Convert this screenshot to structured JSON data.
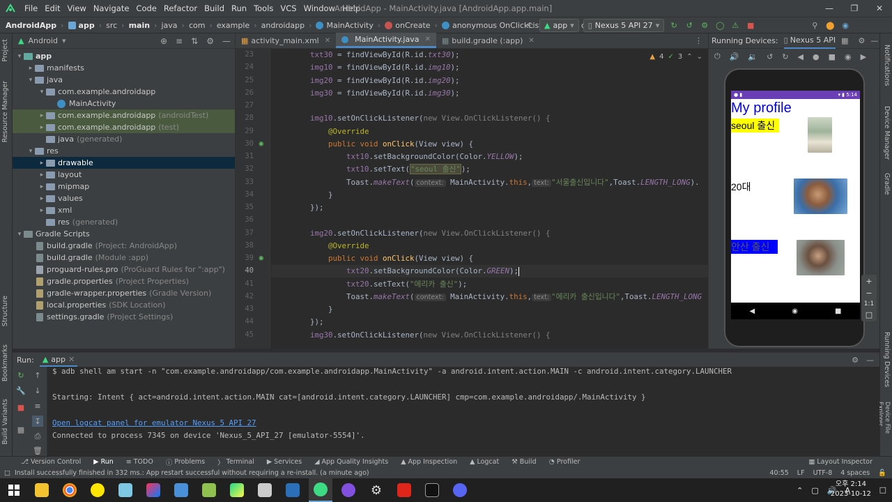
{
  "menu": [
    "File",
    "Edit",
    "View",
    "Navigate",
    "Code",
    "Refactor",
    "Build",
    "Run",
    "Tools",
    "VCS",
    "Window",
    "Help"
  ],
  "window_title": "AndroidApp - MainActivity.java [AndroidApp.app.main]",
  "breadcrumb": [
    "AndroidApp",
    "app",
    "src",
    "main",
    "java",
    "com",
    "example",
    "androidapp",
    "MainActivity",
    "onCreate",
    "anonymous OnClickListener",
    "onClick"
  ],
  "run_config": {
    "module": "app",
    "device": "Nexus 5 API 27"
  },
  "project_panel": {
    "view": "Android"
  },
  "tree": [
    {
      "label": "app",
      "extra": ""
    },
    {
      "label": "manifests",
      "extra": ""
    },
    {
      "label": "java",
      "extra": ""
    },
    {
      "label": "com.example.androidapp",
      "extra": ""
    },
    {
      "label": "MainActivity",
      "extra": ""
    },
    {
      "label": "com.example.androidapp",
      "extra": "(androidTest)"
    },
    {
      "label": "com.example.androidapp",
      "extra": "(test)"
    },
    {
      "label": "java",
      "extra": "(generated)"
    },
    {
      "label": "res",
      "extra": ""
    },
    {
      "label": "drawable",
      "extra": ""
    },
    {
      "label": "layout",
      "extra": ""
    },
    {
      "label": "mipmap",
      "extra": ""
    },
    {
      "label": "values",
      "extra": ""
    },
    {
      "label": "xml",
      "extra": ""
    },
    {
      "label": "res",
      "extra": "(generated)"
    },
    {
      "label": "Gradle Scripts",
      "extra": ""
    },
    {
      "label": "build.gradle",
      "extra": "(Project: AndroidApp)"
    },
    {
      "label": "build.gradle",
      "extra": "(Module :app)"
    },
    {
      "label": "proguard-rules.pro",
      "extra": "(ProGuard Rules for \":app\")"
    },
    {
      "label": "gradle.properties",
      "extra": "(Project Properties)"
    },
    {
      "label": "gradle-wrapper.properties",
      "extra": "(Gradle Version)"
    },
    {
      "label": "local.properties",
      "extra": "(SDK Location)"
    },
    {
      "label": "settings.gradle",
      "extra": "(Project Settings)"
    }
  ],
  "editor_tabs": [
    "activity_main.xml",
    "MainActivity.java",
    "build.gradle (:app)"
  ],
  "inspection": {
    "warnings": "4",
    "ok": "3"
  },
  "line_numbers": [
    "23",
    "24",
    "25",
    "26",
    "27",
    "28",
    "29",
    "30",
    "31",
    "32",
    "33",
    "34",
    "35",
    "36",
    "37",
    "38",
    "39",
    "40",
    "41",
    "42",
    "43",
    "44",
    "45"
  ],
  "devices": {
    "title": "Running Devices:",
    "tab": "Nexus 5 API"
  },
  "emulator": {
    "time": "5:14",
    "profile_title": "My profile",
    "row1": "seoul 출신",
    "row2": "20대",
    "row3": "안산 출신",
    "zoom_label": "1:1"
  },
  "run": {
    "label": "Run:",
    "config": "app",
    "lines": [
      "$ adb shell am start -n \"com.example.androidapp/com.example.androidapp.MainActivity\" -a android.intent.action.MAIN -c android.intent.category.LAUNCHER",
      "Starting: Intent { act=android.intent.action.MAIN cat=[android.intent.category.LAUNCHER] cmp=com.example.androidapp/.MainActivity }",
      "Open logcat panel for emulator Nexus 5 API 27",
      "Connected to process 7345 on device 'Nexus_5_API_27 [emulator-5554]'."
    ]
  },
  "bottom_tools": [
    "Version Control",
    "Run",
    "TODO",
    "Problems",
    "Terminal",
    "Services",
    "App Quality Insights",
    "App Inspection",
    "Logcat",
    "Build",
    "Profiler"
  ],
  "layout_inspector": "Layout Inspector",
  "status": {
    "message": "Install successfully finished in 332 ms.: App restart successful without requiring a re-install. (a minute ago)",
    "position": "40:55",
    "line_sep": "LF",
    "encoding": "UTF-8",
    "indent": "4 spaces"
  },
  "left_tabs": [
    "Project",
    "Resource Manager",
    "Structure",
    "Bookmarks",
    "Build Variants"
  ],
  "right_tabs": [
    "Notifications",
    "Device Manager",
    "Gradle",
    "Running Devices",
    "Device File Explorer"
  ],
  "taskbar": {
    "time": "오후 2:14",
    "date": "2023-10-12",
    "ime": "A"
  },
  "code": {
    "l23": [
      "txt30",
      " = findViewById(R.id.",
      "txt30",
      ");"
    ],
    "l24": [
      "img10",
      " = findViewById(R.id.",
      "img10",
      ");"
    ],
    "l25": [
      "img20",
      " = findViewById(R.id.",
      "img20",
      ");"
    ],
    "l26": [
      "img30",
      " = findViewById(R.id.",
      "img30",
      ");"
    ],
    "l28": [
      "img10",
      ".setOnClickListener(",
      "new View.OnClickListener() {"
    ],
    "l29": "@Override",
    "l30": [
      "public void ",
      "onClick",
      "(View view) {"
    ],
    "l31": [
      "txt10",
      ".setBackgroundColor(Color.",
      "YELLOW",
      ");"
    ],
    "l32": [
      "txt10",
      ".setText(",
      "\"seoul 출신\"",
      ");"
    ],
    "l33": [
      "Toast.",
      "makeText",
      "(",
      "context:",
      " MainActivity.",
      "this",
      ",",
      "text:",
      "\"서울출신입니다\"",
      ",Toast.",
      "LENGTH_LONG",
      ")."
    ],
    "l34": "}",
    "l35": "});",
    "l37": [
      "img20",
      ".setOnClickListener(",
      "new View.OnClickListener() {"
    ],
    "l38": "@Override",
    "l39": [
      "public void ",
      "onClick",
      "(View view) {"
    ],
    "l40": [
      "txt20",
      ".setBackgroundColor(Color.",
      "GREEN",
      ");"
    ],
    "l41": [
      "txt20",
      ".setText(",
      "\"에리카 출신\"",
      ");"
    ],
    "l42": [
      "Toast.",
      "makeText",
      "(",
      "context:",
      " MainActivity.",
      "this",
      ",",
      "text:",
      "\"에리카 출신입니다\"",
      ",Toast.",
      "LENGTH_LONG"
    ],
    "l43": "}",
    "l44": "});",
    "l45": [
      "img30",
      ".setOnClickListener(",
      "new View.OnClickListener() {"
    ]
  }
}
